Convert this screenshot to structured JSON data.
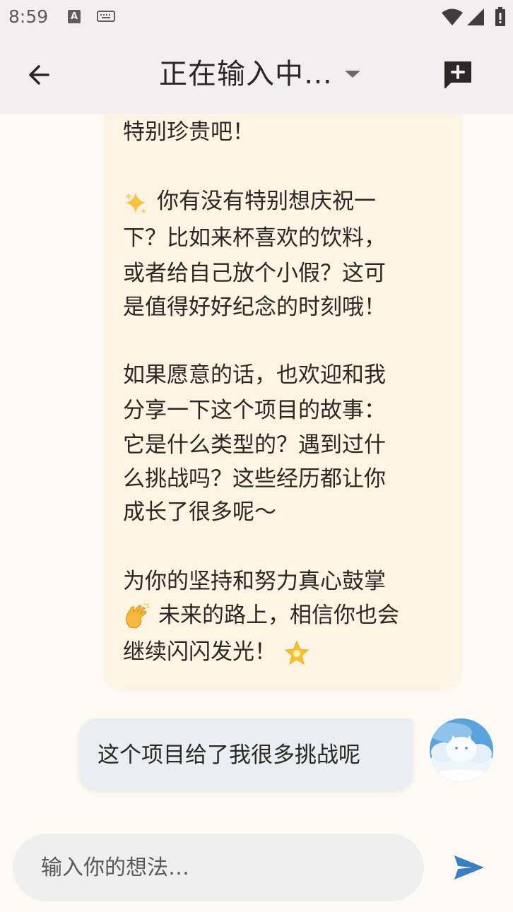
{
  "status_bar": {
    "time": "8:59",
    "icons": [
      "text-a-icon",
      "keyboard-icon",
      "wifi-icon",
      "signal-icon",
      "battery-icon"
    ]
  },
  "app_bar": {
    "title": "正在输入中…",
    "back_icon": "back-arrow-icon",
    "dropdown_icon": "caret-down-icon",
    "new_chat_icon": "new-message-icon"
  },
  "messages": {
    "bot": {
      "lines": [
        "特别珍贵吧！",
        "你有没有特别想庆祝一",
        "下？比如来杯喜欢的饮料，",
        "或者给自己放个小假？这可",
        "是值得好好纪念的时刻哦！",
        "如果愿意的话，也欢迎和我",
        "分享一下这个项目的故事：",
        "它是什么类型的？遇到过什",
        "么挑战吗？这些经历都让你",
        "成长了很多呢～",
        "为你的坚持和努力真心鼓掌",
        "未来的路上，相信你也会",
        "继续闪闪发光！"
      ],
      "emojis": [
        "sparkles-icon",
        "clapping-hands-icon",
        "glowing-star-icon"
      ]
    },
    "user": {
      "text": "这个项目给了我很多挑战呢",
      "avatar": "cloud-cat-avatar"
    }
  },
  "composer": {
    "placeholder": "输入你的想法…",
    "send_icon": "send-icon"
  },
  "colors": {
    "background": "#fdf9f3",
    "app_bar": "#f1efef",
    "bot_bubble": "#fef4e4",
    "user_bubble": "#e9eef2",
    "send_accent": "#3b7ec2"
  }
}
